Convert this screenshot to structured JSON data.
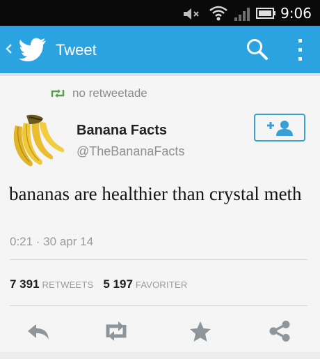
{
  "status_bar": {
    "time": "9:06",
    "icons": [
      "mute-icon",
      "wifi-icon",
      "signal-icon",
      "battery-icon"
    ]
  },
  "action_bar": {
    "title": "Tweet",
    "icons": [
      "back-icon",
      "twitter-bird-icon",
      "search-icon",
      "overflow-menu-icon"
    ]
  },
  "tweet": {
    "retweet_context": "no retweetade",
    "author_name": "Banana Facts",
    "author_handle": "@TheBananaFacts",
    "text": "bananas are healthier than crystal meth",
    "timestamp": "0:21 · 30 apr 14"
  },
  "stats": {
    "retweets_count": "7 391",
    "retweets_label": "RETWEETS",
    "favorites_count": "5 197",
    "favorites_label": "FAVORITER"
  },
  "actions": [
    "reply-icon",
    "retweet-icon",
    "favorite-icon",
    "share-icon"
  ],
  "colors": {
    "action_bar": "#2ba3e0",
    "status_bar": "#0a0a0a",
    "background": "#f4f5f4",
    "retweet_green": "#5c9d4c",
    "icon_gray": "#9aa0a6",
    "follow_blue": "#3a9fd6"
  }
}
